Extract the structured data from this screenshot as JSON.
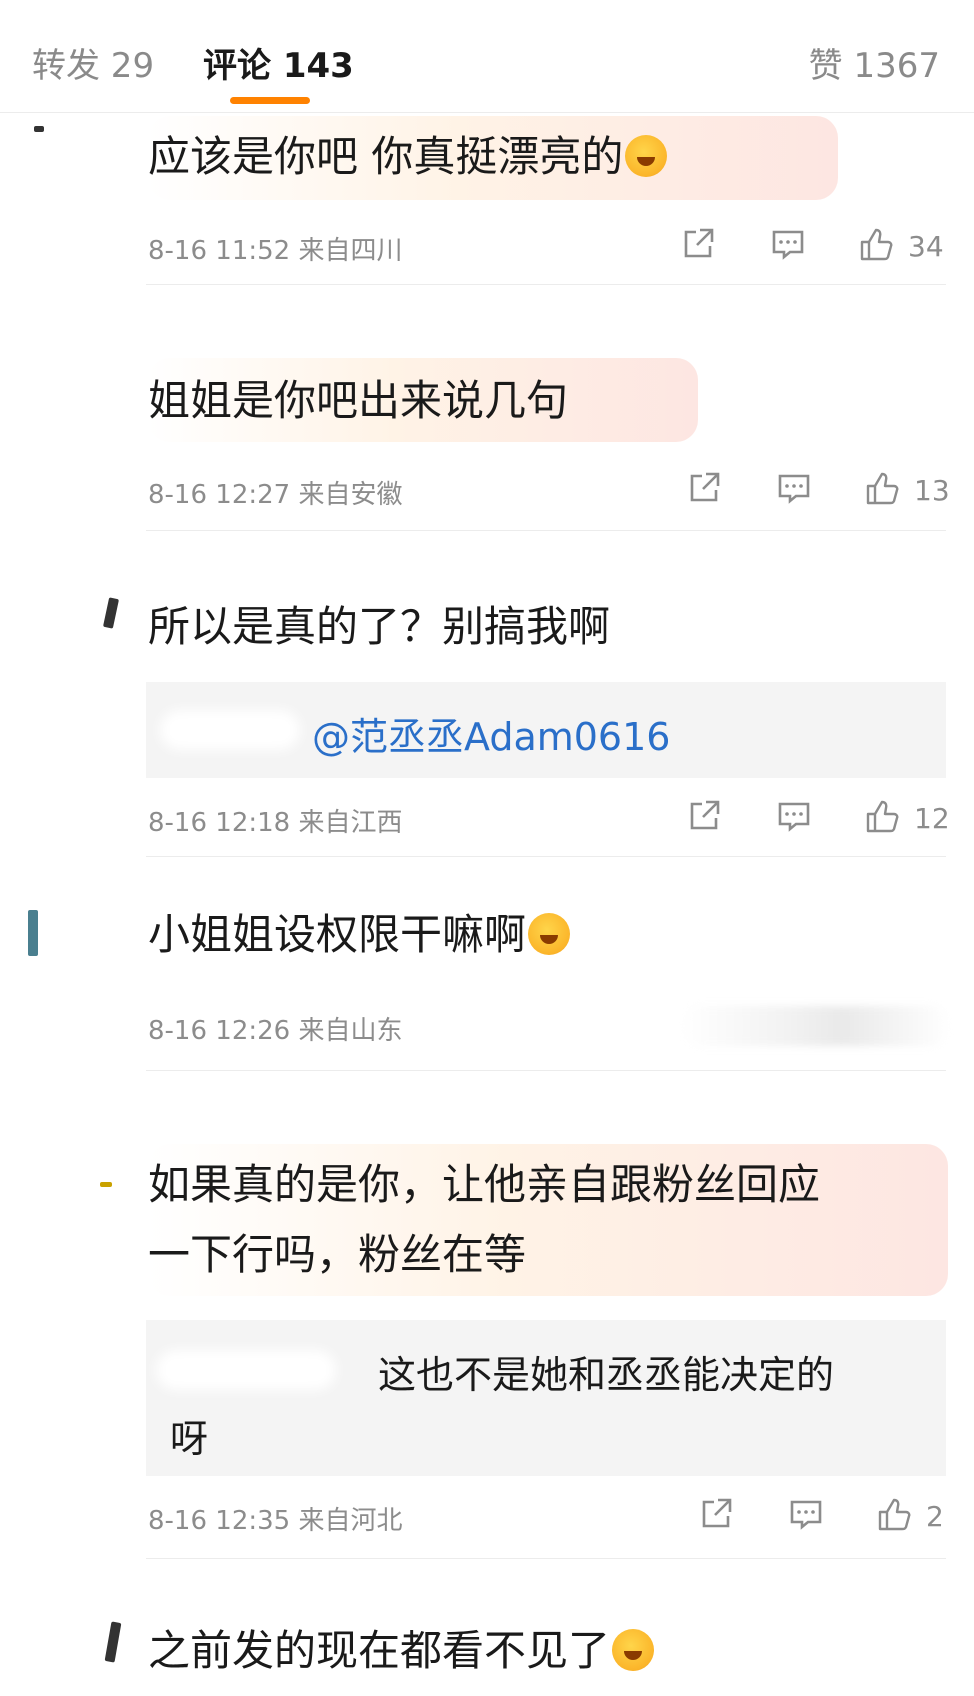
{
  "tabs": {
    "repost": "转发 29",
    "comments": "评论 143",
    "likes": "赞 1367"
  },
  "colors": {
    "accent": "#ff8200",
    "mention": "#2a6fc9",
    "meta": "#8c8c8c"
  },
  "comments": [
    {
      "text": "应该是你吧 你真挺漂亮的",
      "emoji": "crying-face",
      "time": "8-16 11:52",
      "location": "来自四川",
      "likes": "34"
    },
    {
      "text": "姐姐是你吧出来说几句",
      "time": "8-16 12:27",
      "location": "来自安徽",
      "likes": "13"
    },
    {
      "text": "所以是真的了？别搞我啊",
      "reply": {
        "mention": "@范丞丞Adam0616"
      },
      "time": "8-16 12:18",
      "location": "来自江西",
      "likes": "12"
    },
    {
      "text": "小姐姐设权限干嘛啊",
      "emoji": "winking-tongue-face",
      "time": "8-16 12:26",
      "location": "来自山东"
    },
    {
      "text_line1": "如果真的是你，让他亲自跟粉丝回应",
      "text_line2": "一下行吗，粉丝在等",
      "reply": {
        "text_line1": "这也不是她和丞丞能决定的",
        "text_line2": "呀"
      },
      "time": "8-16 12:35",
      "location": "来自河北",
      "likes": "2"
    },
    {
      "text": "之前发的现在都看不见了",
      "emoji": "crying-laughing-face"
    }
  ],
  "icons": {
    "share": "share-icon",
    "comment": "comment-icon",
    "like": "thumbs-up-icon"
  }
}
